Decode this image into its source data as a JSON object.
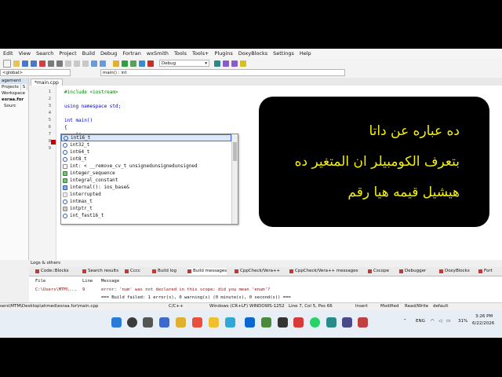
{
  "menu": [
    "Edit",
    "View",
    "Search",
    "Project",
    "Build",
    "Debug",
    "Fortran",
    "wxSmith",
    "Tools",
    "Tools+",
    "Plugins",
    "DoxyBlocks",
    "Settings",
    "Help"
  ],
  "toolbar": {
    "build_target": "Debug"
  },
  "toolbar2": {
    "scope": "<global>",
    "function": "main() : int"
  },
  "left_panel": {
    "title": "agement",
    "tabs": [
      "Projects",
      "S"
    ],
    "items": [
      "Workspace",
      "esraa.for",
      "Sourc"
    ]
  },
  "editor": {
    "tab": "*main.cpp",
    "lines": [
      {
        "n": "1",
        "text": "#include <iostream>"
      },
      {
        "n": "2",
        "text": ""
      },
      {
        "n": "3",
        "text": "using namespace std;"
      },
      {
        "n": "4",
        "text": ""
      },
      {
        "n": "5",
        "text": "int main()"
      },
      {
        "n": "6",
        "text": "{"
      },
      {
        "n": "7",
        "text": "    in"
      },
      {
        "n": "8",
        "text": ""
      },
      {
        "n": "9",
        "text": ""
      }
    ]
  },
  "autocomplete": [
    "int16_t",
    "int32_t",
    "int64_t",
    "int8_t",
    "int: < __remove_cv_t unsignedunsignedunsigned",
    "integer_sequence",
    "integral_constant",
    "internal(): ios_base&",
    "interrupted",
    "intmax_t",
    "intptr_t",
    "int_fast16_t"
  ],
  "overlay": {
    "line1": "ده عباره عن داتا",
    "line2": "بتعرف الكومبيلر ان المتغير ده",
    "line3": "هيشيل قيمه هيا رقم"
  },
  "logs": {
    "title": "Logs & others",
    "tabs": [
      "Code::Blocks",
      "Search results",
      "Cccc",
      "Build log",
      "Build messages",
      "CppCheck/Vera++",
      "CppCheck/Vera++ messages",
      "Cscope",
      "Debugger",
      "DoxyBlocks",
      "Fort"
    ],
    "headers": [
      "File",
      "Line",
      "Message"
    ],
    "rows": [
      {
        "file": "C:\\Users\\MTM\\...",
        "line": "9",
        "message": "error: 'num' was not declared in this scope; did you mean 'enum'?"
      },
      {
        "file": "",
        "line": "",
        "message": "=== Build failed: 1 error(s), 0 warning(s) (0 minute(s), 0 second(s)) ==="
      }
    ]
  },
  "status": {
    "path": "sers\\MTM\\Desktop\\ahmed\\esraa.for\\main.cpp",
    "lang": "C/C++",
    "eol": "Windows (CR+LF)",
    "encoding": "WINDOWS-1252",
    "position": "Line 7, Col 5, Pos 66",
    "mode": "Insert",
    "modified": "Modified",
    "rw": "Read/Write",
    "profile": "default"
  },
  "taskbar": {
    "lang": "ENG",
    "battery": "31%",
    "time": "3:26 PM",
    "date": "6/22/2026"
  },
  "colors": {
    "accent": "#3b74d6",
    "overlay_text": "#f5f000",
    "error": "#c00000"
  }
}
